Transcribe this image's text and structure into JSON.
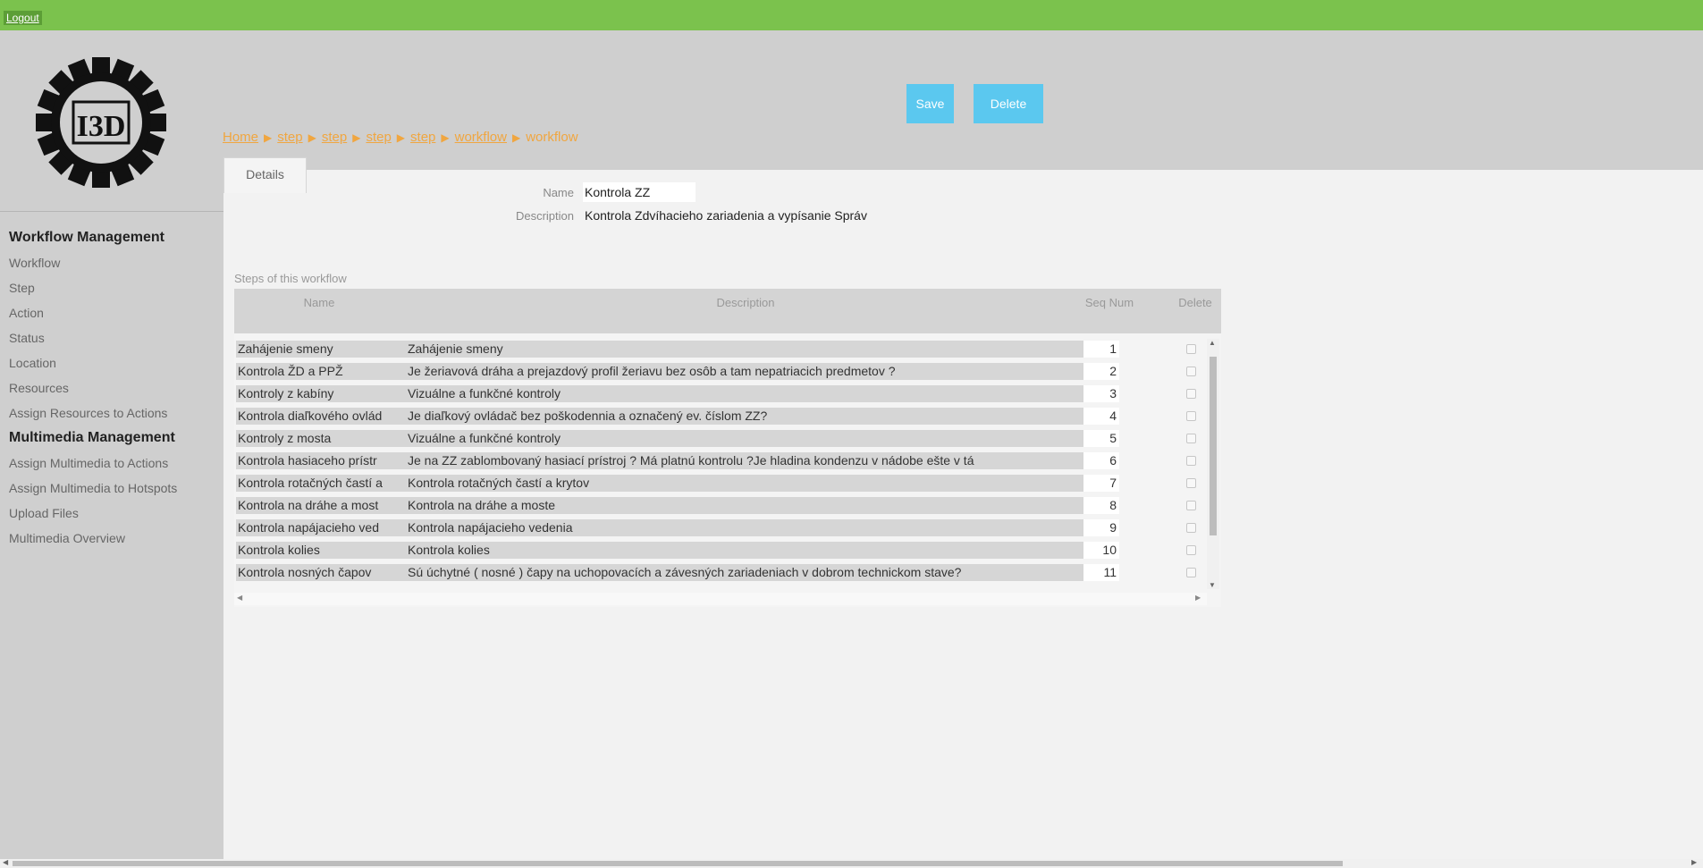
{
  "topbar": {
    "logout_label": "Logout",
    "color": "#7bc24d"
  },
  "logo": {
    "text": "I3D"
  },
  "toolbar": {
    "save_label": "Save",
    "delete_label": "Delete",
    "button_color": "#5bc8ef"
  },
  "breadcrumb": {
    "items": [
      "Home",
      "step",
      "step",
      "step",
      "step",
      "workflow",
      "workflow"
    ],
    "separator": "▶",
    "color": "#f0a640"
  },
  "tabs": {
    "details_label": "Details"
  },
  "sidebar": {
    "groups": [
      {
        "title": "Workflow Management",
        "items": [
          "Workflow",
          "Step",
          "Action",
          "Status",
          "Location",
          "Resources",
          "Assign Resources to Actions"
        ]
      },
      {
        "title": "Multimedia Management",
        "items": [
          "Assign Multimedia to Actions",
          "Assign Multimedia to Hotspots",
          "Upload Files",
          "Multimedia Overview"
        ]
      }
    ]
  },
  "form": {
    "name_label": "Name",
    "name_value": "Kontrola ZZ",
    "description_label": "Description",
    "description_value": "Kontrola Zdvíhacieho zariadenia a vypísanie Správ"
  },
  "steps": {
    "caption": "Steps of this workflow",
    "columns": {
      "name": "Name",
      "description": "Description",
      "seq": "Seq Num",
      "delete": "Delete"
    },
    "rows": [
      {
        "name": "Zahájenie smeny",
        "description": "Zahájenie smeny",
        "seq": "1"
      },
      {
        "name": "Kontrola ŽD a PPŽ",
        "description": "Je žeriavová dráha a prejazdový profil žeriavu bez osôb a tam nepatriacich predmetov ?",
        "seq": "2"
      },
      {
        "name": "Kontroly z kabíny",
        "description": "Vizuálne a funkčné kontroly",
        "seq": "3"
      },
      {
        "name": "Kontrola diaľkového ovlád",
        "description": "Je diaľkový ovládač  bez poškodennia a označený ev. číslom ZZ?",
        "seq": "4"
      },
      {
        "name": "Kontroly z mosta",
        "description": "Vizuálne a funkčné kontroly",
        "seq": "5"
      },
      {
        "name": "Kontrola hasiaceho prístr",
        "description": "Je na ZZ zablombovaný hasiací prístroj ? Má platnú kontrolu ?Je hladina kondenzu v nádobe ešte v tá",
        "seq": "6"
      },
      {
        "name": "Kontrola rotačných častí a",
        "description": "Kontrola rotačných častí a krytov",
        "seq": "7"
      },
      {
        "name": "Kontrola na dráhe a most",
        "description": "Kontrola na dráhe a moste",
        "seq": "8"
      },
      {
        "name": "Kontrola napájacieho ved",
        "description": "Kontrola napájacieho vedenia",
        "seq": "9"
      },
      {
        "name": "Kontrola kolies",
        "description": "Kontrola kolies",
        "seq": "10"
      },
      {
        "name": "Kontrola nosných čapov",
        "description": "Sú úchytné ( nosné ) čapy na uchopovacích a závesných  zariadeniach v dobrom technickom stave?",
        "seq": "11"
      }
    ]
  }
}
